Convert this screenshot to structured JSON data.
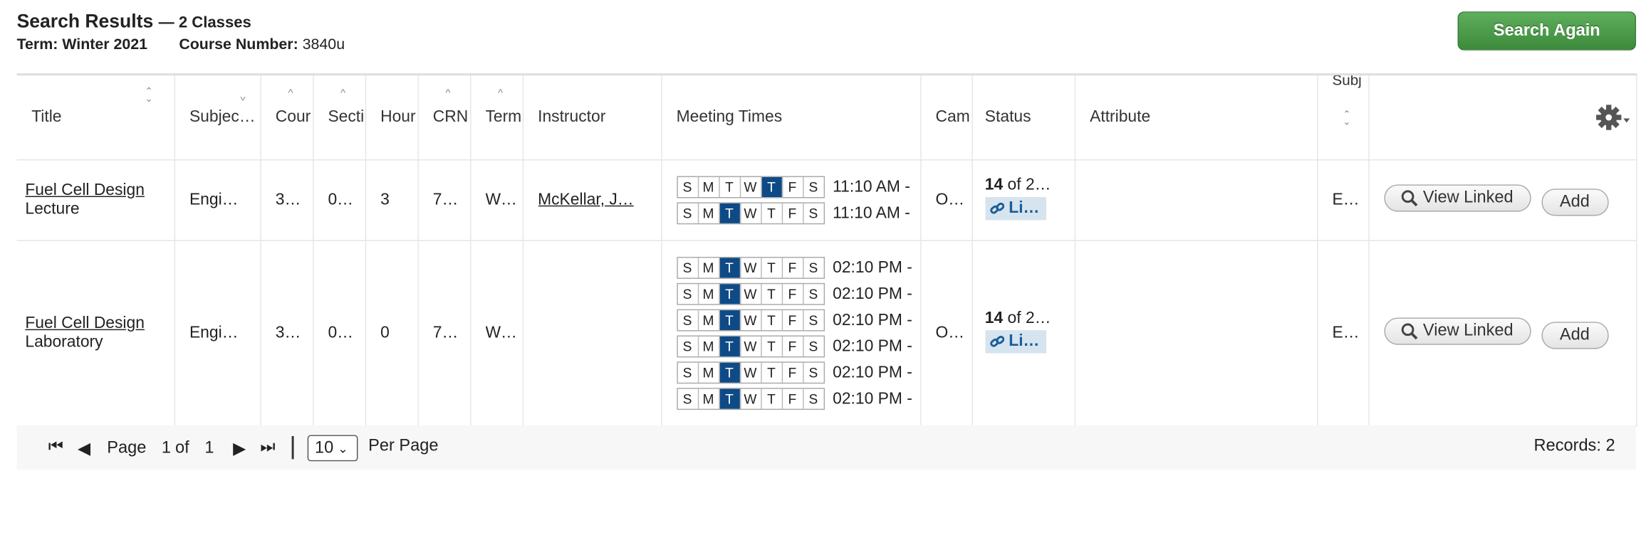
{
  "header": {
    "title": "Search Results",
    "count_text": "— 2 Classes",
    "term_label": "Term:",
    "term_value": "Winter 2021",
    "course_label": "Course Number:",
    "course_value": "3840u",
    "search_again_label": "Search Again"
  },
  "columns": [
    "Title",
    "Subject D",
    "Cour",
    "Secti",
    "Hour",
    "CRN",
    "Term",
    "Instructor",
    "Meeting Times",
    "Cam",
    "Status",
    "Attribute",
    "Subj"
  ],
  "rows": [
    {
      "title": "Fuel Cell Design",
      "schedule_type": "Lecture",
      "subject": "Engi…",
      "course": "3…",
      "section": "0…",
      "hours": "3",
      "crn": "7…",
      "term": "W…",
      "instructor": "McKellar, J…",
      "meetings": [
        {
          "days": [
            "S",
            "M",
            "T",
            "W",
            "T",
            "F",
            "S"
          ],
          "active": [
            4
          ],
          "time": "11:10 AM -"
        },
        {
          "days": [
            "S",
            "M",
            "T",
            "W",
            "T",
            "F",
            "S"
          ],
          "active": [
            2
          ],
          "time": "11:10 AM -"
        }
      ],
      "campus": "O…",
      "status_seats": "14",
      "status_rest": " of 2…",
      "linked_label": "Li…",
      "attribute": "",
      "subj2": "E…",
      "view_linked_label": "View Linked",
      "add_label": "Add"
    },
    {
      "title": "Fuel Cell Design",
      "schedule_type": "Laboratory",
      "subject": "Engi…",
      "course": "3…",
      "section": "0…",
      "hours": "0",
      "crn": "7…",
      "term": "W…",
      "instructor": "",
      "meetings": [
        {
          "days": [
            "S",
            "M",
            "T",
            "W",
            "T",
            "F",
            "S"
          ],
          "active": [
            2
          ],
          "time": "02:10 PM -"
        },
        {
          "days": [
            "S",
            "M",
            "T",
            "W",
            "T",
            "F",
            "S"
          ],
          "active": [
            2
          ],
          "time": "02:10 PM -"
        },
        {
          "days": [
            "S",
            "M",
            "T",
            "W",
            "T",
            "F",
            "S"
          ],
          "active": [
            2
          ],
          "time": "02:10 PM -"
        },
        {
          "days": [
            "S",
            "M",
            "T",
            "W",
            "T",
            "F",
            "S"
          ],
          "active": [
            2
          ],
          "time": "02:10 PM -"
        },
        {
          "days": [
            "S",
            "M",
            "T",
            "W",
            "T",
            "F",
            "S"
          ],
          "active": [
            2
          ],
          "time": "02:10 PM -"
        },
        {
          "days": [
            "S",
            "M",
            "T",
            "W",
            "T",
            "F",
            "S"
          ],
          "active": [
            2
          ],
          "time": "02:10 PM -"
        }
      ],
      "campus": "O…",
      "status_seats": "14",
      "status_rest": " of 2…",
      "linked_label": "Li…",
      "attribute": "",
      "subj2": "E…",
      "view_linked_label": "View Linked",
      "add_label": "Add"
    }
  ],
  "pager": {
    "page_label": "Page",
    "page_current": "1",
    "of_label": "of",
    "page_total": "1",
    "per_page_value": "10",
    "per_page_label": "Per Page",
    "records_text": "Records: 2"
  },
  "colors": {
    "active_day": "#0e4a86",
    "search_again": "#4a9a48",
    "linked_bg": "#d6e4ef"
  }
}
